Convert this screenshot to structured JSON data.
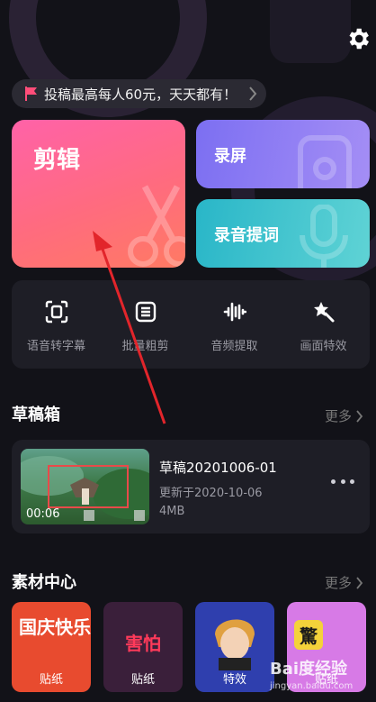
{
  "banner": {
    "text": "投稿最高每人60元，天天都有！"
  },
  "tiles": {
    "edit": "剪辑",
    "record": "录屏",
    "teleprompter": "录音提词"
  },
  "tools": [
    {
      "label": "语音转字幕",
      "icon": "subtitle-icon"
    },
    {
      "label": "批量粗剪",
      "icon": "batch-list-icon"
    },
    {
      "label": "音频提取",
      "icon": "waveform-icon"
    },
    {
      "label": "画面特效",
      "icon": "magic-wand-icon"
    }
  ],
  "drafts": {
    "title": "草稿箱",
    "more": "更多",
    "item": {
      "name": "草稿20201006-01",
      "updated": "更新于2020-10-06",
      "size": "4MB",
      "duration": "00:06"
    }
  },
  "materials": {
    "title": "素材中心",
    "more": "更多",
    "items": [
      {
        "label": "贴纸",
        "art": "国庆快乐",
        "bg": "#e84b2f"
      },
      {
        "label": "贴纸",
        "art": "害怕",
        "bg": "#3a1f3a"
      },
      {
        "label": "特效",
        "art": "",
        "bg": "#2f3fae"
      },
      {
        "label": "贴纸",
        "art": "驚",
        "bg": "#d77ae6"
      }
    ]
  },
  "watermark": {
    "brand": "Bai度经验",
    "url": "jingyan.baidu.com"
  },
  "colors": {
    "background": "#121218",
    "edit_tile": "#ff6b8f",
    "record_tile": "#8f7ff3",
    "teleprompter_tile": "#3cc3cc"
  }
}
